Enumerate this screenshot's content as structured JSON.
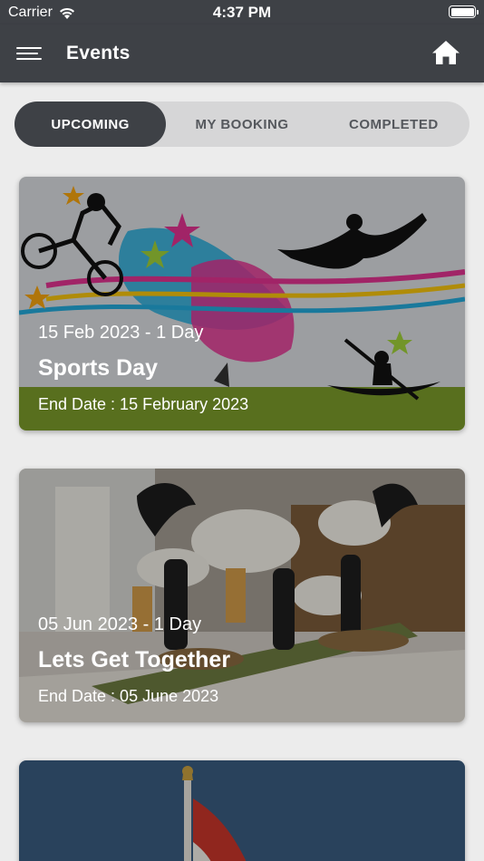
{
  "status_bar": {
    "carrier": "Carrier",
    "time": "4:37 PM"
  },
  "navbar": {
    "title": "Events",
    "menu_icon": "hamburger-icon",
    "home_icon": "home-icon"
  },
  "tabs": [
    {
      "label": "UPCOMING",
      "active": true
    },
    {
      "label": "MY BOOKING",
      "active": false
    },
    {
      "label": "COMPLETED",
      "active": false
    }
  ],
  "events": [
    {
      "date_range": "15 Feb 2023 - 1 Day",
      "name": "Sports Day",
      "end_date": "End Date : 15 February 2023"
    },
    {
      "date_range": "05 Jun 2023 - 1 Day",
      "name": "Lets Get Together",
      "end_date": "End Date : 05 June 2023"
    },
    {
      "date_range": "",
      "name": "",
      "end_date": ""
    }
  ],
  "colors": {
    "bar": "#3e4146",
    "tab_track": "#d6d6d7",
    "background": "#ececec"
  }
}
